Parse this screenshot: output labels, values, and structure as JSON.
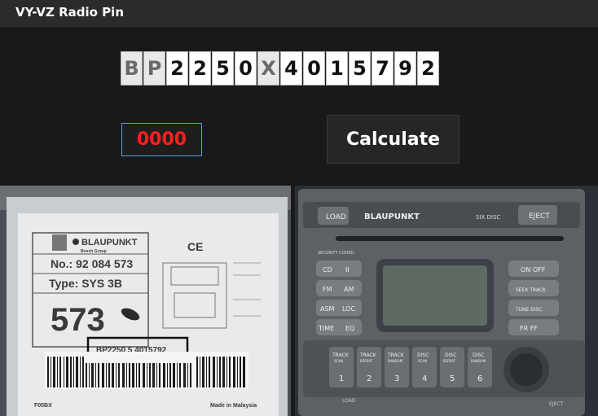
{
  "app": {
    "title": "VY-VZ Radio Pin"
  },
  "serial": {
    "prefix": [
      "B",
      "P"
    ],
    "chars": [
      "2",
      "2",
      "5",
      "0",
      "X",
      "4",
      "0",
      "1",
      "5",
      "7",
      "9",
      "2"
    ]
  },
  "pin": {
    "value": "0000",
    "color": "#ff1f1f"
  },
  "calculate": {
    "label": "Calculate"
  },
  "label_photo": {
    "brand": "BLAUPUNKT",
    "brand_sub": "Bosch Group",
    "no_label": "No.: 92 084 573",
    "type_label": "Type: SYS 3B",
    "code": "573",
    "serial_box": "BP2250 5 4015792",
    "made_in": "Made in Malaysia",
    "footer_code": "F05BX",
    "ce_mark": "CE"
  },
  "radio_photo": {
    "brand": "BLAUPUNKT",
    "load": "LOAD",
    "eject": "EJECT",
    "six_disc": "SIX DISC",
    "security": "SECURITY CODED",
    "left_buttons": [
      {
        "a": "CD",
        "b": "II"
      },
      {
        "a": "FM",
        "b": "AM"
      },
      {
        "a": "ASM",
        "b": "LOC"
      },
      {
        "a": "TIME",
        "b": "EQ"
      }
    ],
    "right_buttons": [
      "ON  OFF",
      "SEEK TRACK",
      "TUNE DISC",
      "FR   FF"
    ],
    "bottom_buttons": [
      {
        "label": "TRACK",
        "sub": "SCAN",
        "num": "1"
      },
      {
        "label": "TRACK",
        "sub": "REPEAT",
        "num": "2"
      },
      {
        "label": "TRACK",
        "sub": "RANDOM",
        "num": "3"
      },
      {
        "label": "DISC",
        "sub": "SCAN",
        "num": "4"
      },
      {
        "label": "DISC",
        "sub": "REPEAT",
        "num": "5"
      },
      {
        "label": "DISC",
        "sub": "RANDOM",
        "num": "6"
      }
    ],
    "bottom_load": "LOAD",
    "bottom_eject": "EJECT"
  }
}
